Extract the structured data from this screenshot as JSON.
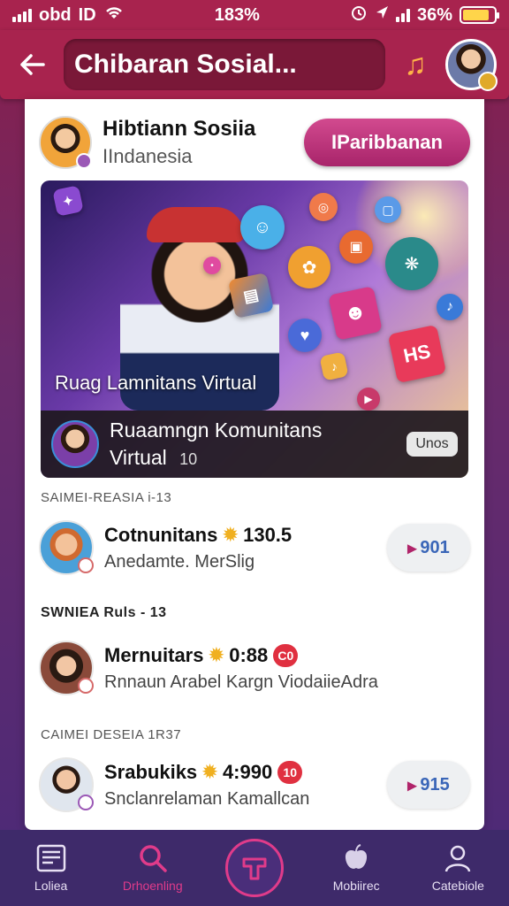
{
  "status_bar": {
    "carrier": "obd",
    "network": "ID",
    "time": "183%",
    "battery_percent_text": "36%",
    "battery_level": 0.85,
    "battery_color": "#ffd54a"
  },
  "app_bar": {
    "title": "Chibaran Sosial...",
    "back_icon": "arrow-left-icon",
    "music_icon": "music-note-icon"
  },
  "profile": {
    "name": "Hibtiann Sosiia",
    "subtitle": "IIndanesia",
    "action_label": "IParibbanan"
  },
  "hero": {
    "caption": "Ruag Lamnitans Virtual",
    "title": "Ruaamngn Komunitans",
    "subtitle": "Virtual",
    "subtitle_suffix": "10",
    "tag": "Unos"
  },
  "sections": [
    {
      "label": "SAIMEI-REASIA i-13",
      "item": {
        "title": "Cotnunitans",
        "count": "130.5",
        "subtitle": "Anedamte. MerSlig",
        "button_count": "901"
      }
    },
    {
      "label": "SWNIEA Ruls - 13",
      "item": {
        "title": "Mernuitars",
        "count": "0:88",
        "badge": "C0",
        "subtitle": "Rnnaun Arabel Kargn ViodaiieAdra"
      }
    },
    {
      "label": "CAIMEI DESEIA 1R37",
      "item": {
        "title": "Srabukiks",
        "count": "4:990",
        "badge": "10",
        "subtitle": "Snclanrelaman Kamallcan",
        "button_count": "915"
      }
    }
  ],
  "bottom_nav": [
    {
      "label": "Loliea",
      "icon": "news-icon"
    },
    {
      "label": "Drhoenling",
      "icon": "search-icon",
      "active": true
    },
    {
      "label": "",
      "icon": "create-icon"
    },
    {
      "label": "Mobiirec",
      "icon": "apple-icon"
    },
    {
      "label": "Catebiole",
      "icon": "profile-icon"
    }
  ]
}
